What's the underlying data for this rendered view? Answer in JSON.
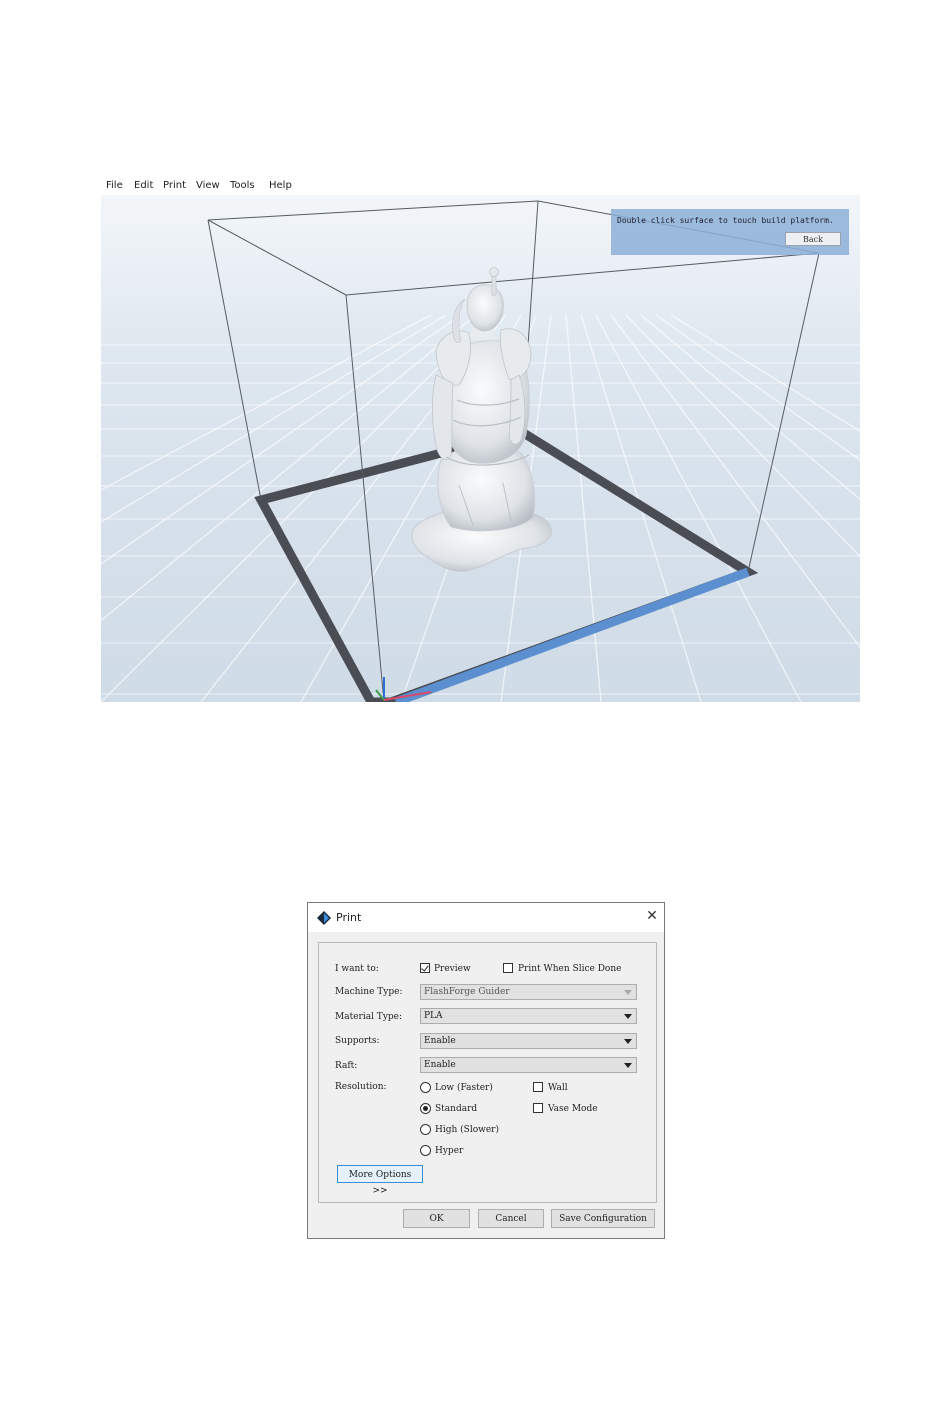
{
  "app": {
    "menu": [
      "File",
      "Edit",
      "Print",
      "View",
      "Tools",
      "Help"
    ],
    "hint": {
      "text": "Double click surface to touch build platform.",
      "back_label": "Back"
    }
  },
  "dialog": {
    "title": "Print",
    "close_glyph": "✕",
    "i_want_to": {
      "label": "I want to:",
      "preview_label": "Preview",
      "preview_checked": true,
      "print_when_done_label": "Print When Slice Done",
      "print_when_done_checked": false
    },
    "machine_type": {
      "label": "Machine Type:",
      "value": "FlashForge Guider"
    },
    "material_type": {
      "label": "Material Type:",
      "value": "PLA"
    },
    "supports": {
      "label": "Supports:",
      "value": "Enable"
    },
    "raft": {
      "label": "Raft:",
      "value": "Enable"
    },
    "resolution": {
      "label": "Resolution:",
      "options": [
        "Low (Faster)",
        "Standard",
        "High (Slower)",
        "Hyper"
      ],
      "selected": "Standard"
    },
    "wall": {
      "label": "Wall",
      "checked": false
    },
    "vase_mode": {
      "label": "Vase Mode",
      "checked": false
    },
    "more_options_label": "More Options >>",
    "buttons": {
      "ok": "OK",
      "cancel": "Cancel",
      "save": "Save Configuration"
    }
  },
  "colors": {
    "build_plate_edge_front": "#5b8fd0",
    "build_plate_edge": "#4a4e54",
    "hint_panel": "#8cafd7",
    "model": "#eceef0"
  }
}
